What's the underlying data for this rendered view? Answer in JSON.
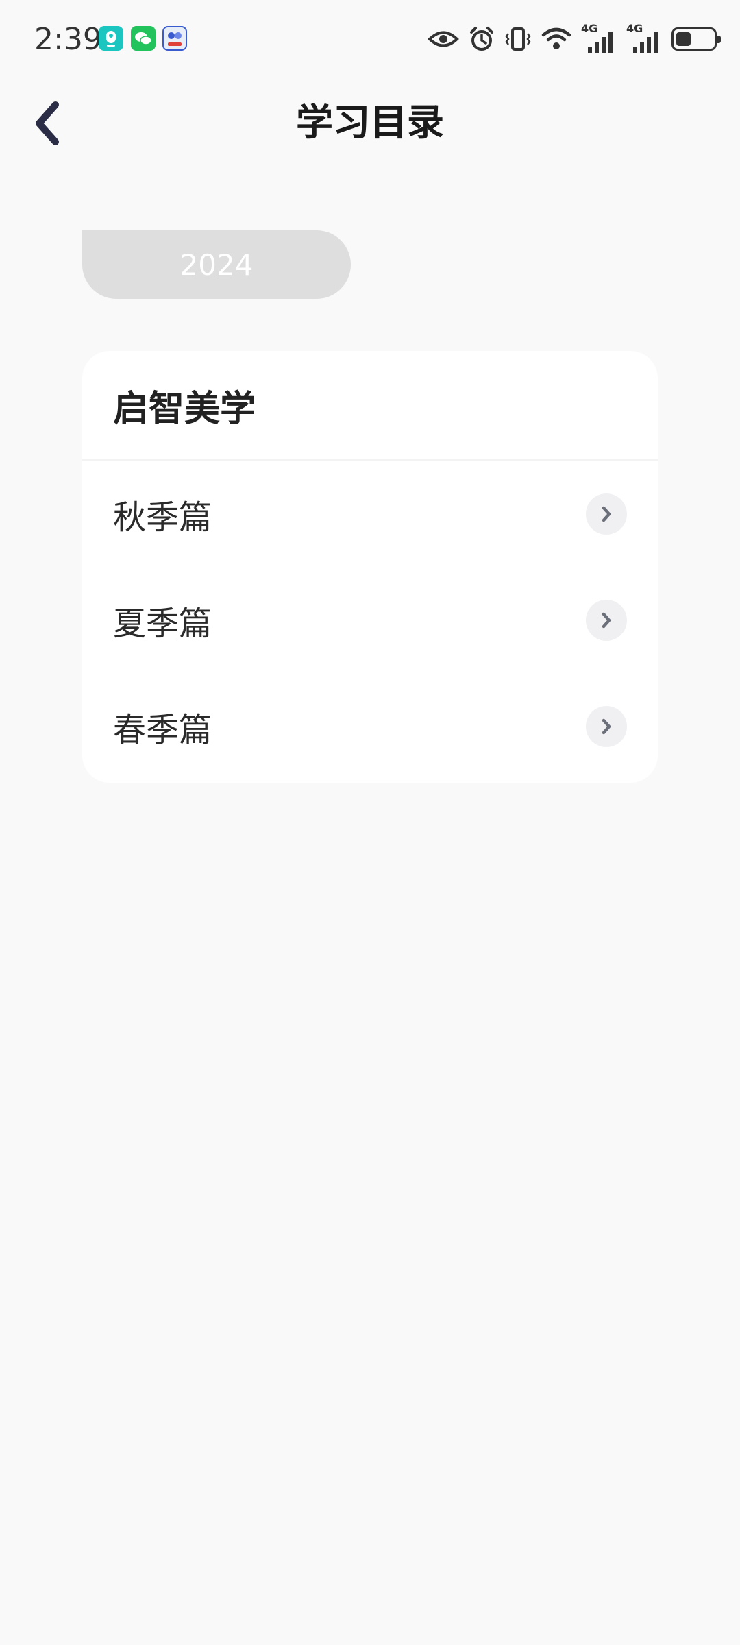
{
  "status_bar": {
    "time": "2:39",
    "network_1": "4G",
    "network_2": "4G",
    "battery_level": 0.4
  },
  "header": {
    "title": "学习目录"
  },
  "year_tab": {
    "label": "2024"
  },
  "course": {
    "title": "启智美学",
    "items": [
      {
        "label": "秋季篇"
      },
      {
        "label": "夏季篇"
      },
      {
        "label": "春季篇"
      }
    ]
  },
  "colors": {
    "background": "#f9f9f9",
    "card": "#ffffff",
    "pill": "#dedede",
    "title_text": "#1a1a1a"
  }
}
